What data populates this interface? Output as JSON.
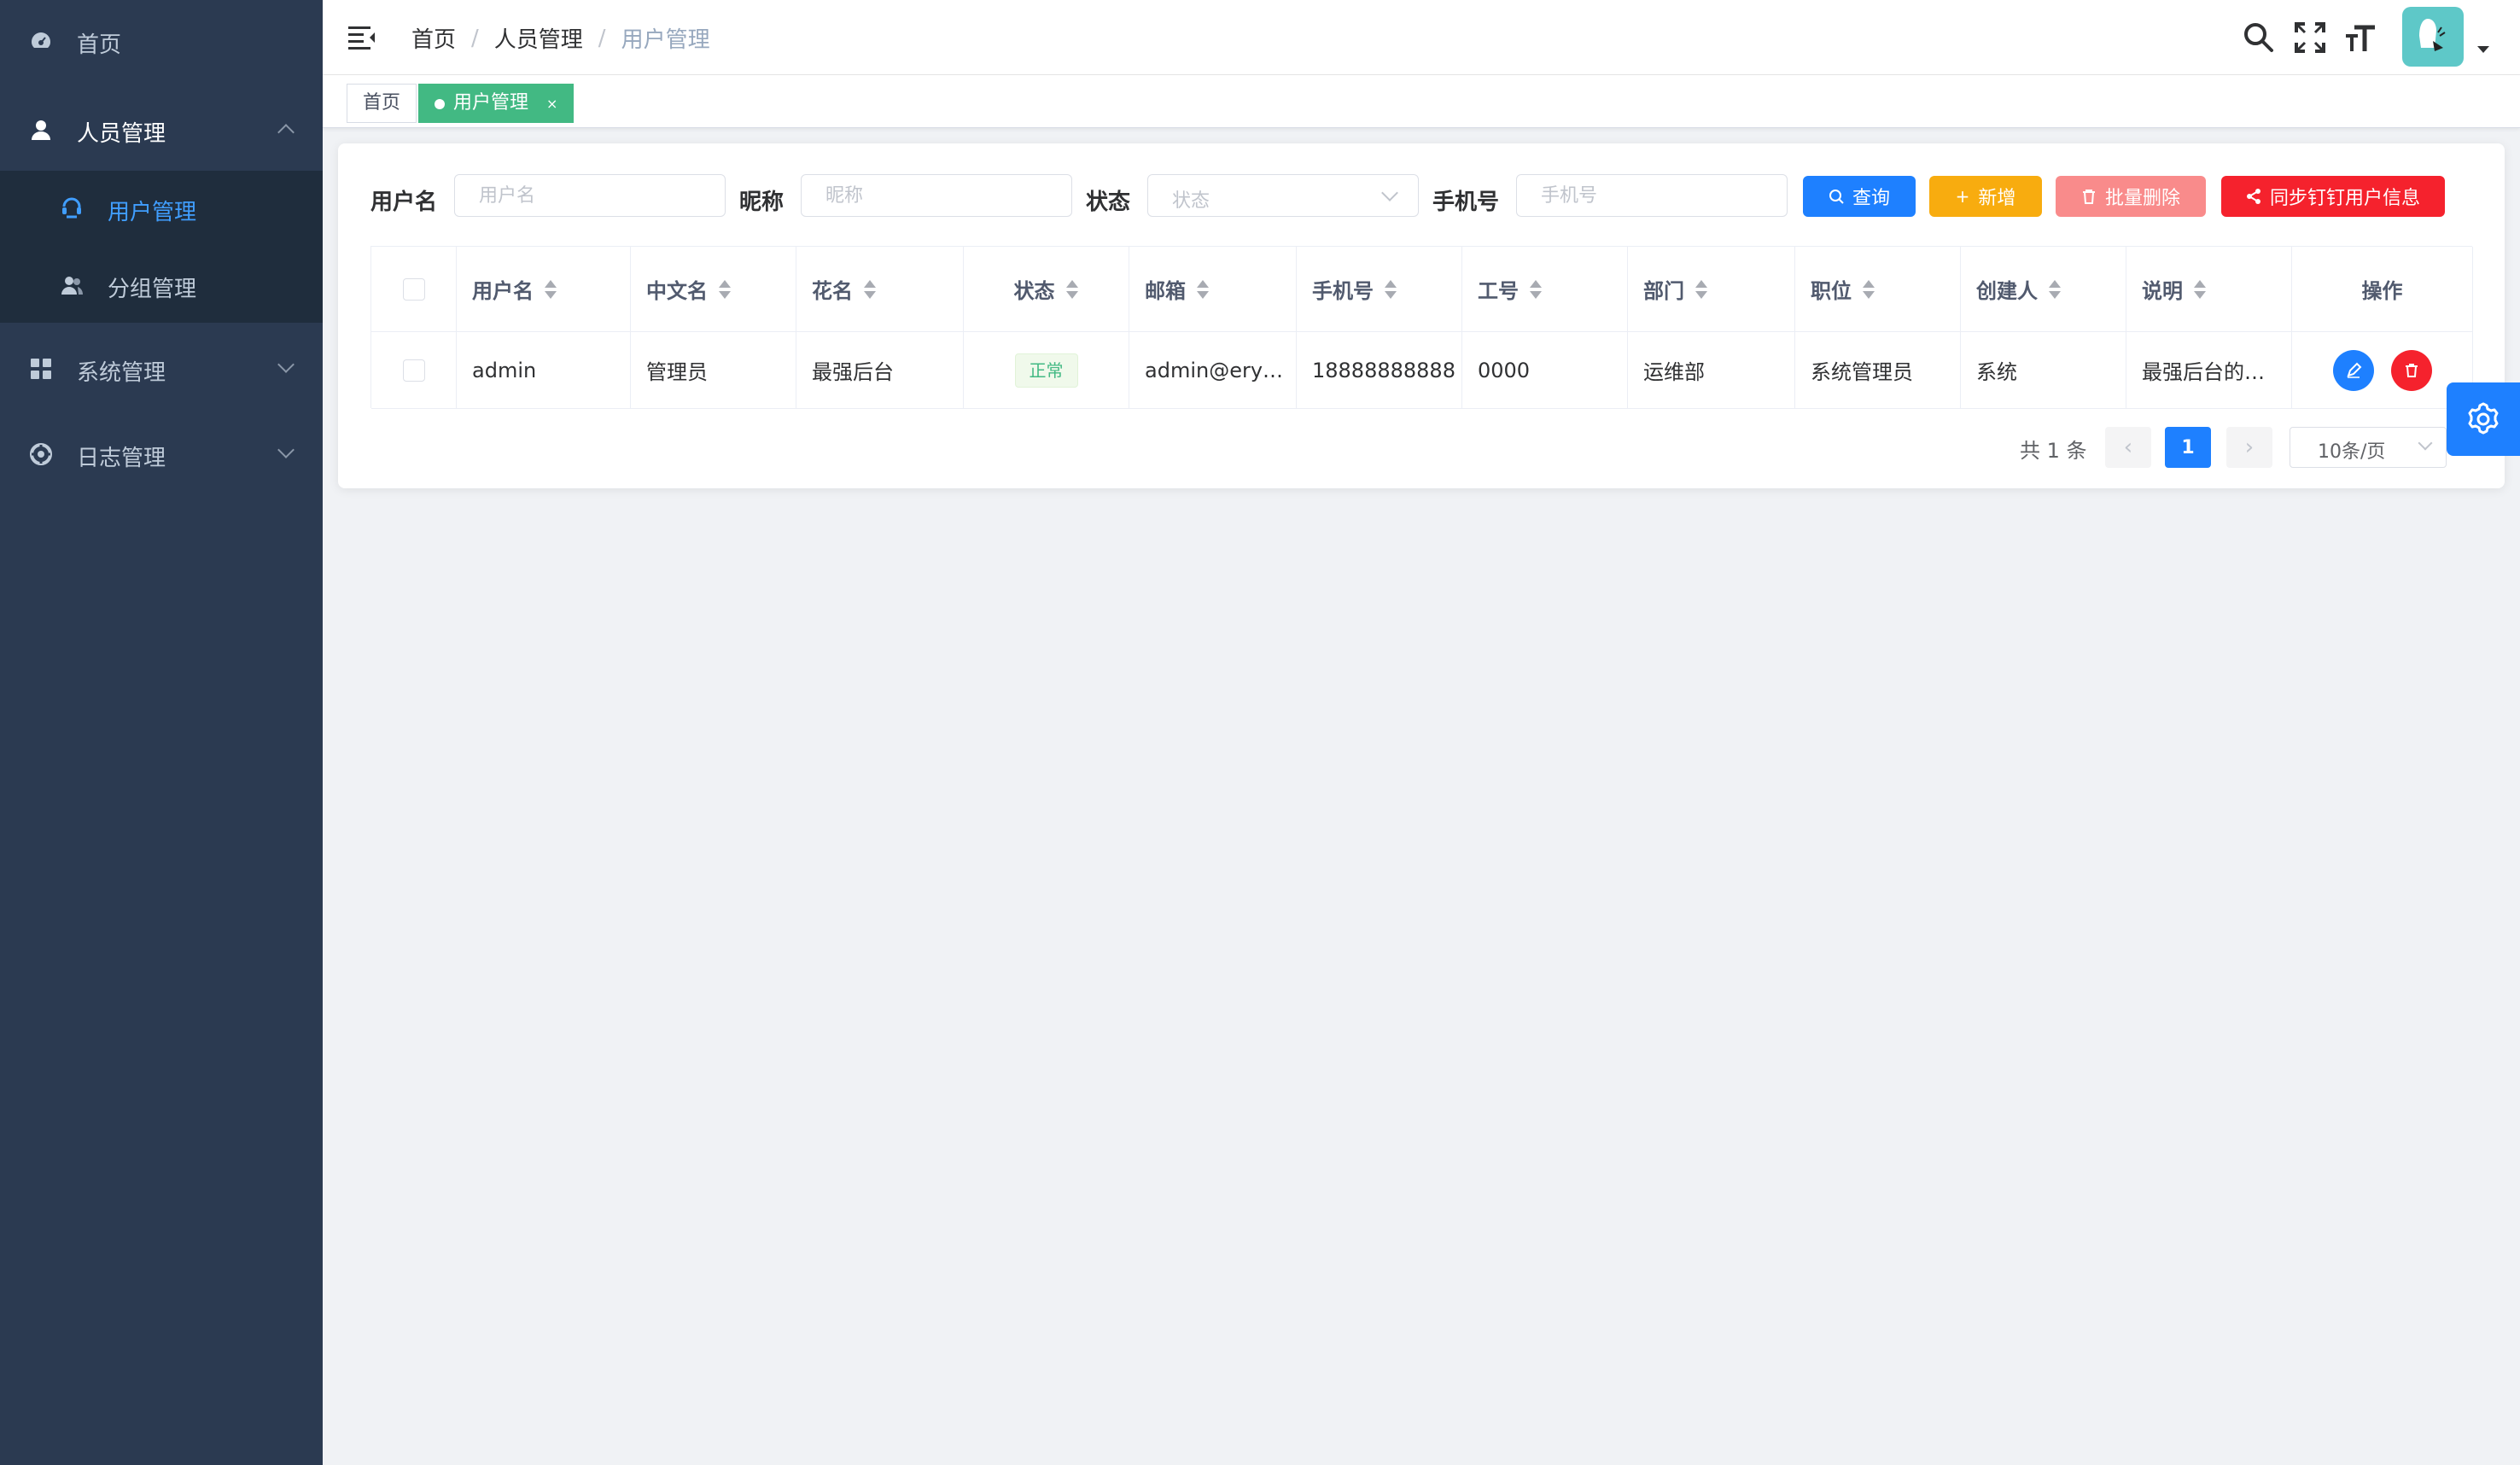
{
  "colors": {
    "sidebar_bg": "#2b3a51",
    "sidebar_sub_bg": "#1f2d3d",
    "menu_active": "#409eff",
    "tag_active": "#42b983",
    "primary": "#1e80ff",
    "warning": "#f8ac0f",
    "danger_light": "#f98b8b",
    "danger": "#f5222d"
  },
  "sidebar": {
    "items": [
      {
        "label": "首页",
        "icon": "dashboard-icon"
      },
      {
        "label": "人员管理",
        "icon": "user-icon"
      },
      {
        "label": "用户管理",
        "icon": "user-manage-icon"
      },
      {
        "label": "分组管理",
        "icon": "group-icon"
      },
      {
        "label": "系统管理",
        "icon": "grid-icon"
      },
      {
        "label": "日志管理",
        "icon": "log-icon"
      }
    ]
  },
  "header": {
    "breadcrumb": [
      "首页",
      "人员管理",
      "用户管理"
    ],
    "separator": "/"
  },
  "tags": {
    "home": "首页",
    "current": "用户管理",
    "close": "×"
  },
  "filters": {
    "username_label": "用户名",
    "username_placeholder": "用户名",
    "nickname_label": "昵称",
    "nickname_placeholder": "昵称",
    "status_label": "状态",
    "status_placeholder": "状态",
    "phone_label": "手机号",
    "phone_placeholder": "手机号"
  },
  "buttons": {
    "query": "查询",
    "add": "新增",
    "batch_delete": "批量删除",
    "sync": "同步钉钉用户信息"
  },
  "table": {
    "columns": [
      "用户名",
      "中文名",
      "花名",
      "状态",
      "邮箱",
      "手机号",
      "工号",
      "部门",
      "职位",
      "创建人",
      "说明",
      "操作"
    ],
    "rows": [
      {
        "username": "admin",
        "cn_name": "管理员",
        "nickname": "最强后台",
        "status": "正常",
        "email": "admin@ery…",
        "phone": "18888888888",
        "employee_no": "0000",
        "department": "运维部",
        "position": "系统管理员",
        "creator": "系统",
        "description": "最强后台的…"
      }
    ]
  },
  "pagination": {
    "total": "共 1 条",
    "current_page": "1",
    "page_size": "10条/页",
    "prev": "‹",
    "next": "›"
  }
}
